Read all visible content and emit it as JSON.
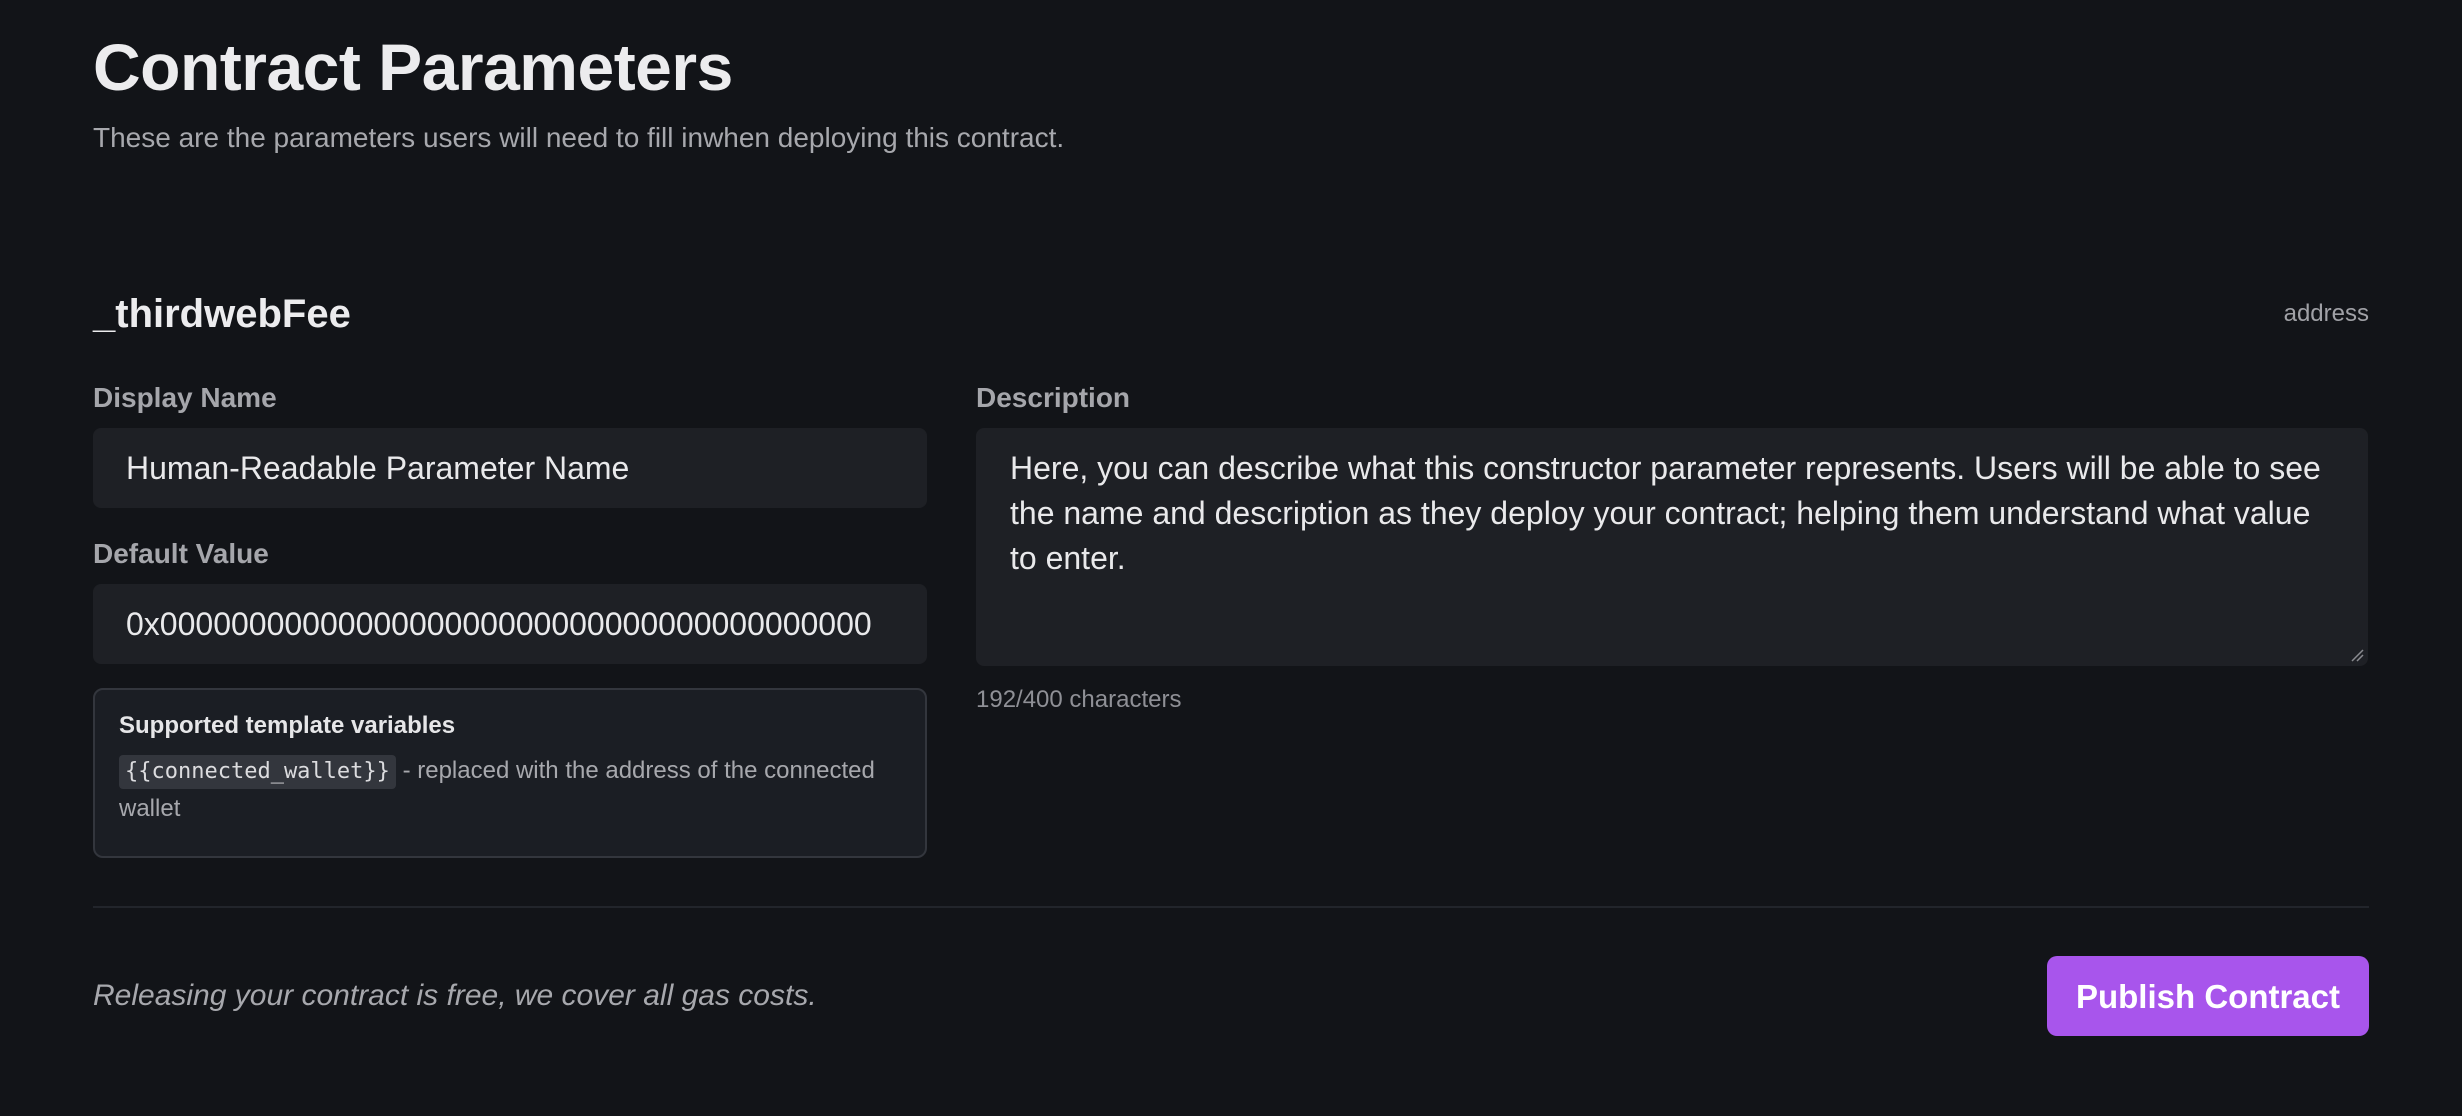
{
  "page": {
    "title": "Contract Parameters",
    "subtitle": "These are the parameters users will need to fill inwhen deploying this contract."
  },
  "parameter": {
    "name": "_thirdwebFee",
    "type": "address",
    "display_name": {
      "label": "Display Name",
      "value": "Human-Readable Parameter Name"
    },
    "default_value": {
      "label": "Default Value",
      "value": "0x0000000000000000000000000000000000000000"
    },
    "template_variables": {
      "title": "Supported template variables",
      "variable": "{{connected_wallet}}",
      "description": "- replaced with the address of the connected wallet"
    },
    "description": {
      "label": "Description",
      "value": "Here, you can describe what this constructor parameter represents. Users will be able to see the name and description as they deploy your contract; helping them understand what value to enter.",
      "char_count": "192/400 characters"
    }
  },
  "footer": {
    "note": "Releasing your contract is free, we cover all gas costs.",
    "publish_label": "Publish Contract"
  },
  "colors": {
    "background": "#121418",
    "input_background": "#1e2025",
    "accent": "#a855ec"
  }
}
